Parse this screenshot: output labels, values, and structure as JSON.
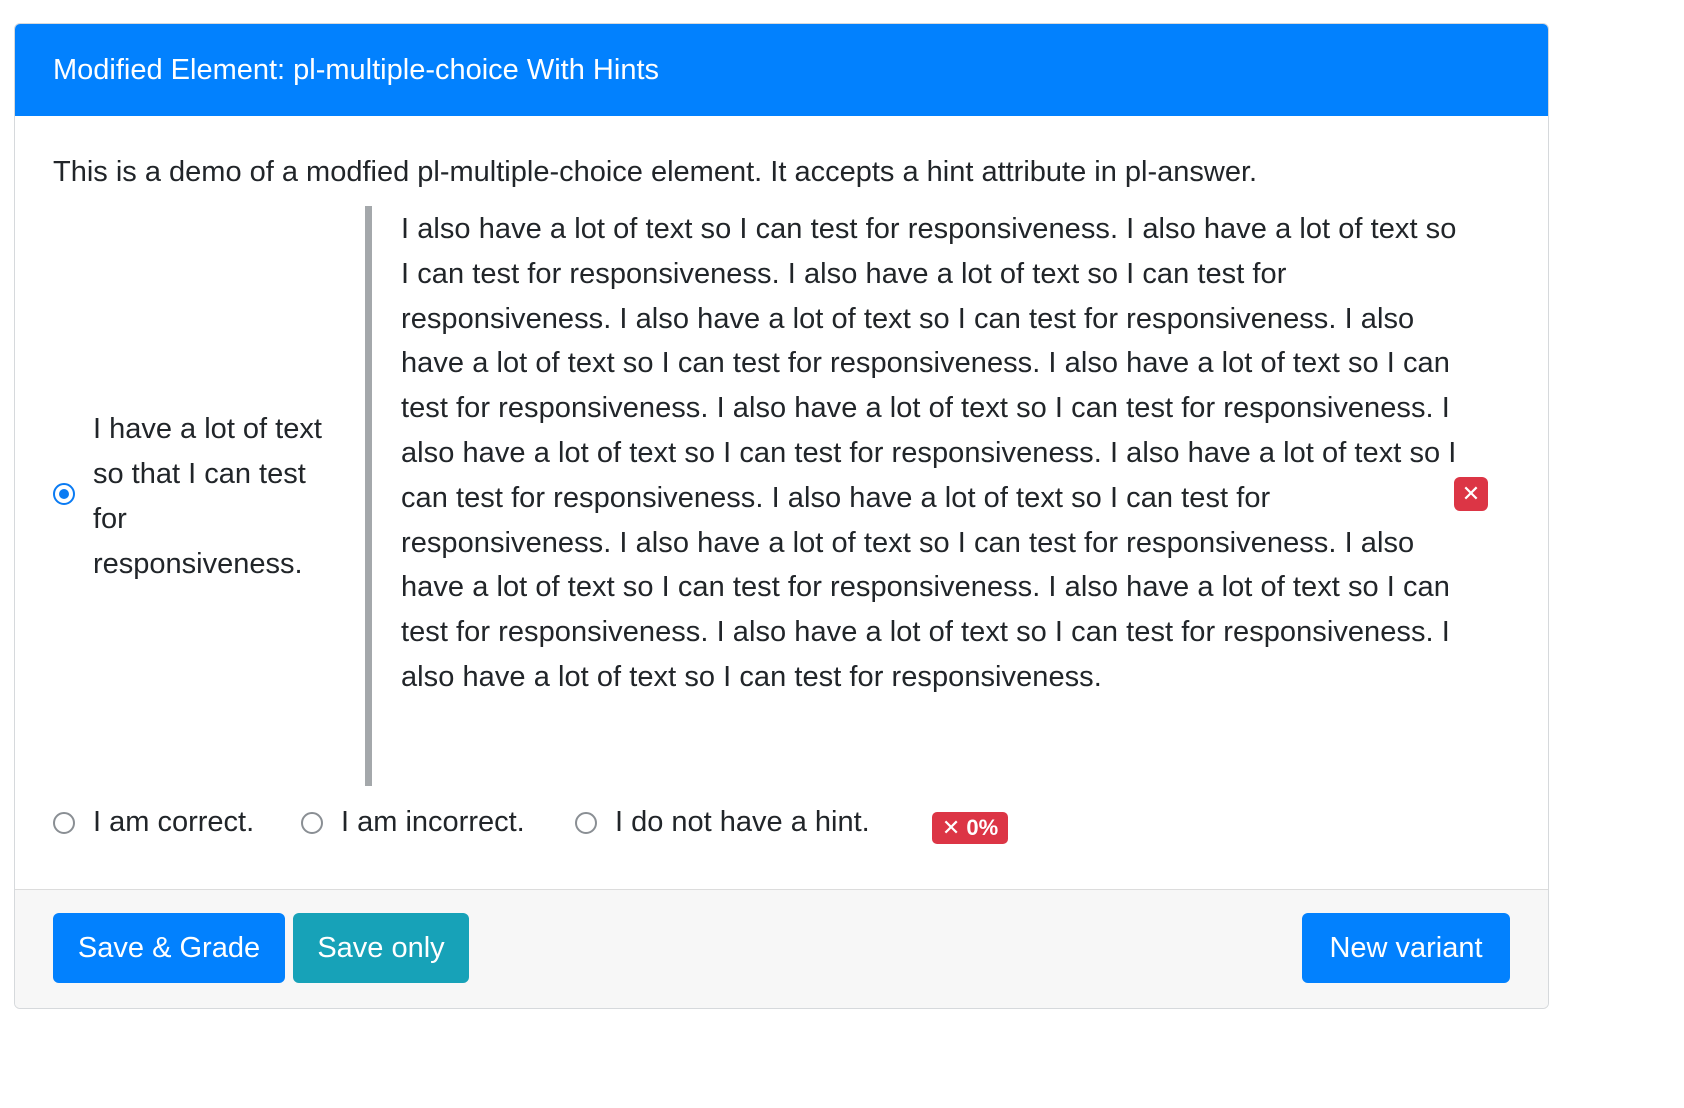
{
  "header": {
    "title": "Modified Element: pl-multiple-choice With Hints"
  },
  "intro": "This is a demo of a modfied pl-multiple-choice element. It accepts a hint attribute in pl-answer.",
  "options": [
    {
      "label": "I have a lot of text so that I can test for responsiveness.",
      "selected": true,
      "hint": "I also have a lot of text so I can test for responsiveness. I also have a lot of text so I can test for responsiveness. I also have a lot of text so I can test for responsiveness. I also have a lot of text so I can test for responsiveness. I also have a lot of text so I can test for responsiveness. I also have a lot of text so I can test for responsiveness. I also have a lot of text so I can test for responsiveness. I also have a lot of text so I can test for responsiveness. I also have a lot of text so I can test for responsiveness. I also have a lot of text so I can test for responsiveness. I also have a lot of text so I can test for responsiveness. I also have a lot of text so I can test for responsiveness. I also have a lot of text so I can test for responsiveness. I also have a lot of text so I can test for responsiveness. I also have a lot of text so I can test for responsiveness.",
      "feedback_badge": "✕"
    },
    {
      "label": "I am correct.",
      "selected": false
    },
    {
      "label": "I am incorrect.",
      "selected": false
    },
    {
      "label": "I do not have a hint.",
      "selected": false
    }
  ],
  "score_badge": "✕ 0%",
  "status_colors": {
    "primary": "#0281fe",
    "info": "#17a2b8",
    "danger": "#dc3545"
  },
  "footer": {
    "save_grade": "Save & Grade",
    "save_only": "Save only",
    "new_variant": "New variant"
  }
}
